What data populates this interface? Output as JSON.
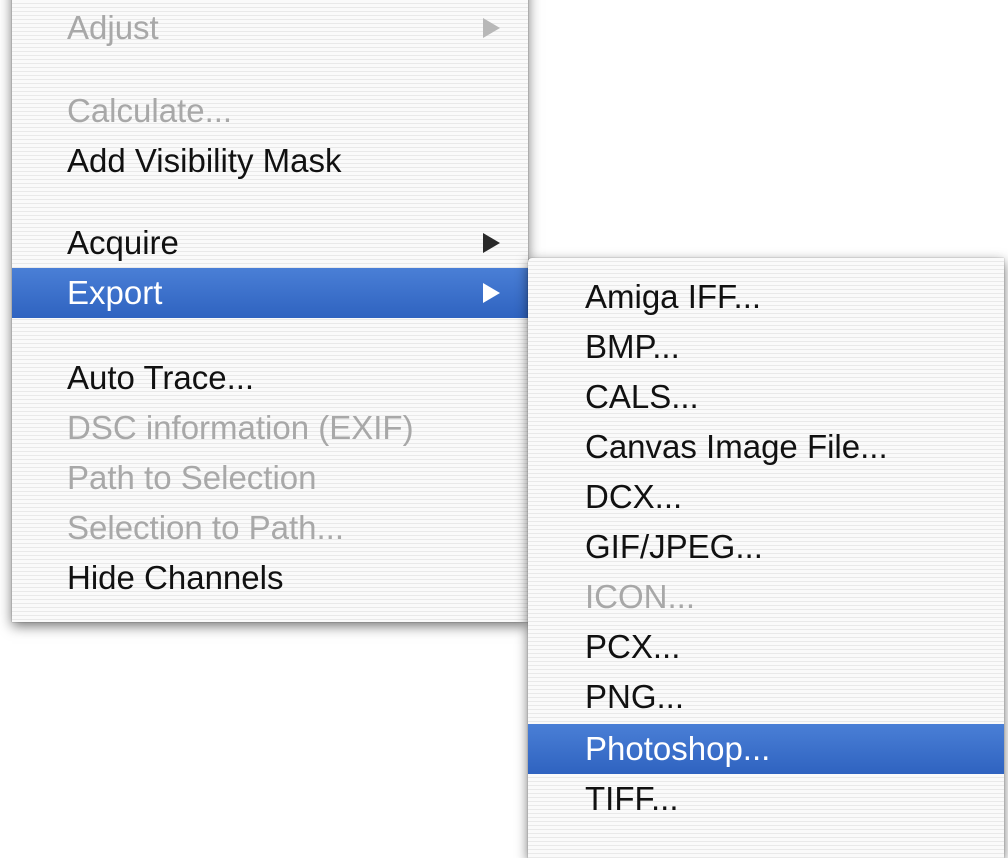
{
  "main_menu": {
    "items": [
      {
        "label": "Adjust",
        "disabled": true,
        "has_submenu": true
      },
      {
        "label": "Calculate...",
        "disabled": true
      },
      {
        "label": "Add Visibility Mask",
        "disabled": false
      },
      {
        "label": "Acquire",
        "disabled": false,
        "has_submenu": true
      },
      {
        "label": "Export",
        "disabled": false,
        "has_submenu": true,
        "selected": true
      },
      {
        "label": "Auto Trace...",
        "disabled": false
      },
      {
        "label": "DSC information (EXIF)",
        "disabled": true
      },
      {
        "label": "Path to Selection",
        "disabled": true
      },
      {
        "label": "Selection to Path...",
        "disabled": true
      },
      {
        "label": "Hide Channels",
        "disabled": false
      }
    ]
  },
  "export_submenu": {
    "items": [
      {
        "label": "Amiga IFF...",
        "disabled": false
      },
      {
        "label": "BMP...",
        "disabled": false
      },
      {
        "label": "CALS...",
        "disabled": false
      },
      {
        "label": "Canvas Image File...",
        "disabled": false
      },
      {
        "label": "DCX...",
        "disabled": false
      },
      {
        "label": "GIF/JPEG...",
        "disabled": false
      },
      {
        "label": "ICON...",
        "disabled": true
      },
      {
        "label": "PCX...",
        "disabled": false
      },
      {
        "label": "PNG...",
        "disabled": false
      },
      {
        "label": "Photoshop...",
        "disabled": false,
        "selected": true
      },
      {
        "label": "TIFF...",
        "disabled": false
      }
    ]
  },
  "colors": {
    "highlight": "#3468c6",
    "disabled_text": "#a8a8a8",
    "text": "#111111"
  }
}
